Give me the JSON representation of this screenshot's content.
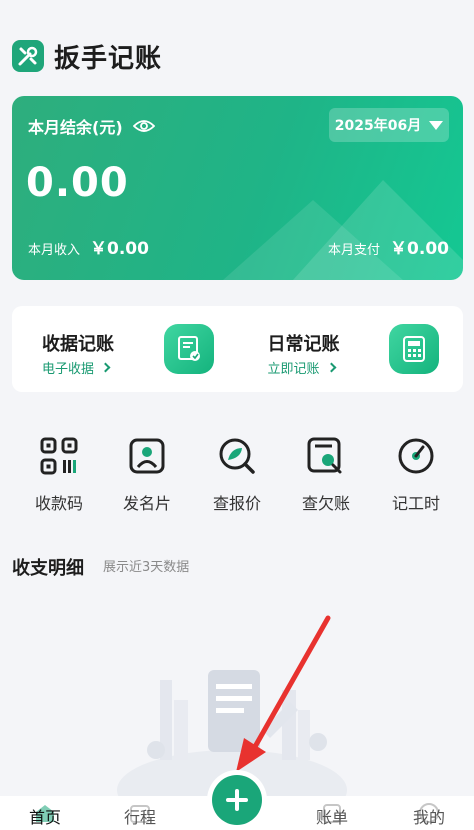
{
  "app": {
    "title": "扳手记账"
  },
  "balance": {
    "label": "本月结余(元)",
    "month": "2025年06月",
    "amount": "0.00",
    "income_label": "本月收入",
    "income_value": "￥0.00",
    "expense_label": "本月支付",
    "expense_value": "￥0.00"
  },
  "entries": [
    {
      "title": "收据记账",
      "sub": "电子收据"
    },
    {
      "title": "日常记账",
      "sub": "立即记账"
    }
  ],
  "quick_actions": [
    {
      "label": "收款码",
      "icon": "qr-code-icon"
    },
    {
      "label": "发名片",
      "icon": "business-card-icon"
    },
    {
      "label": "查报价",
      "icon": "search-quote-icon"
    },
    {
      "label": "查欠账",
      "icon": "search-debt-icon"
    },
    {
      "label": "记工时",
      "icon": "timer-icon"
    }
  ],
  "details": {
    "title": "收支明细",
    "hint": "展示近3天数据"
  },
  "tabbar": [
    {
      "label": "首页",
      "icon": "home-icon"
    },
    {
      "label": "行程",
      "icon": "calendar-icon"
    },
    {
      "label": "账单",
      "icon": "bill-icon"
    },
    {
      "label": "我的",
      "icon": "profile-icon"
    }
  ],
  "colors": {
    "accent": "#1aa679",
    "card_gradient_start": "#2eae7d",
    "card_gradient_end": "#14c893"
  }
}
